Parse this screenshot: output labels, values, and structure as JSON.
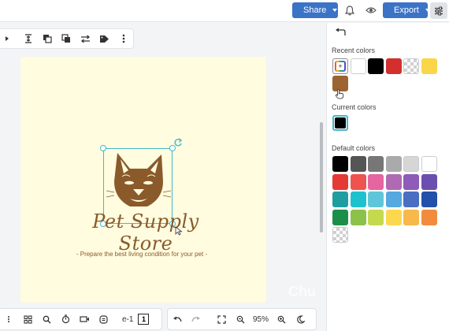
{
  "topbar": {
    "share_label": "Share",
    "export_label": "Export",
    "icons": [
      "bell-icon",
      "eye-icon",
      "sliders-icon"
    ]
  },
  "float_toolbar": {
    "icons": [
      "align-icon",
      "distribute-icon",
      "bring-forward-icon",
      "group-icon",
      "flip-icon",
      "tag-icon",
      "more-icon"
    ]
  },
  "artboard": {
    "background": "#fffcdf",
    "logo_title": "Pet Supply Store",
    "logo_subtitle": "- Prepare the best living condition for your pet -",
    "logo_color": "#8a5a2b",
    "selection_color": "#43b8c9"
  },
  "bottombar": {
    "page_label": "e-1",
    "page_number": "1",
    "zoom": "95%"
  },
  "panel": {
    "recent_title": "Recent colors",
    "current_title": "Current colors",
    "default_title": "Default colors",
    "recent_colors": [
      "#ffffff",
      "#000000",
      "#d32f2f",
      "transparent",
      "#f9d64a",
      "#9c6430"
    ],
    "current_colors": [
      "#000000"
    ],
    "default_colors": [
      [
        "#000000",
        "#555555",
        "#777777",
        "#aaaaaa",
        "#d6d6d6",
        "#ffffff"
      ],
      [
        "#e53935",
        "#ef5350",
        "#e565a0",
        "#b06ab3",
        "#8e5bb8",
        "#6a4fb0"
      ],
      [
        "#1e9ea0",
        "#1ec2cf",
        "#5fc6d9",
        "#56a8e0",
        "#4a6ec2",
        "#2350a8"
      ],
      [
        "#1b8f4a",
        "#8bc34a",
        "#c5d94e",
        "#fcd84f",
        "#f8b84a",
        "#f28b3c"
      ],
      [
        "transparent"
      ]
    ]
  },
  "watermark": "Chu"
}
